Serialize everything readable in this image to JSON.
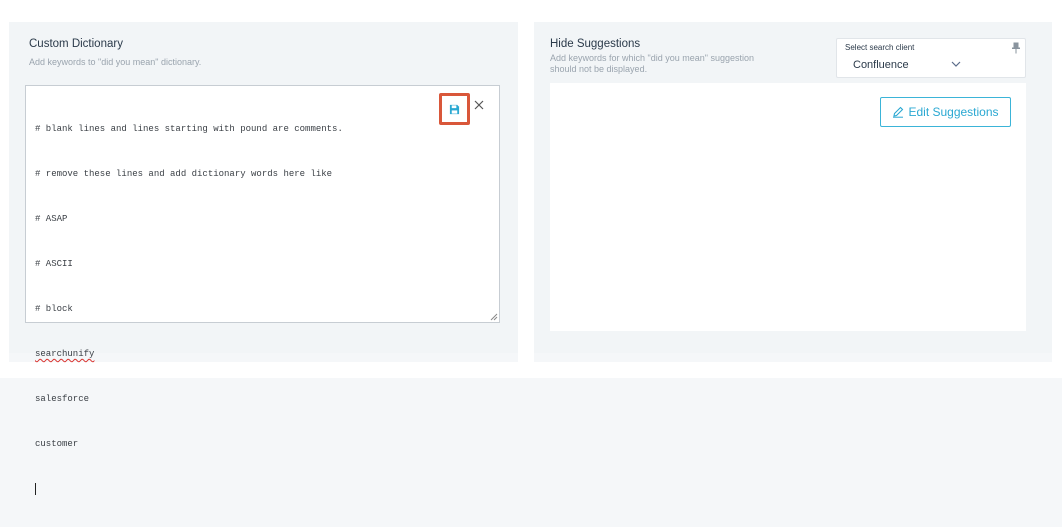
{
  "custom_dictionary": {
    "title": "Custom Dictionary",
    "subtitle": "Add keywords to \"did you mean\" dictionary.",
    "editor_lines": [
      "# blank lines and lines starting with pound are comments.",
      "# remove these lines and add dictionary words here like",
      "# ASAP",
      "# ASCII",
      "# block",
      "searchunify",
      "salesforce",
      "customer"
    ]
  },
  "hide_suggestions": {
    "title": "Hide Suggestions",
    "subtitle_line1": "Add keywords for which \"did you mean\" suggestion",
    "subtitle_line2": "should not be displayed.",
    "client_select": {
      "label": "Select search client",
      "value": "Confluence"
    },
    "edit_button_label": "Edit Suggestions"
  },
  "colors": {
    "accent": "#2aa8d2",
    "highlight": "#d9573a"
  },
  "icons": {
    "save": "floppy-disk-icon",
    "close": "close-icon",
    "pin": "pin-icon",
    "chevron": "chevron-down-icon",
    "edit": "pencil-icon"
  }
}
